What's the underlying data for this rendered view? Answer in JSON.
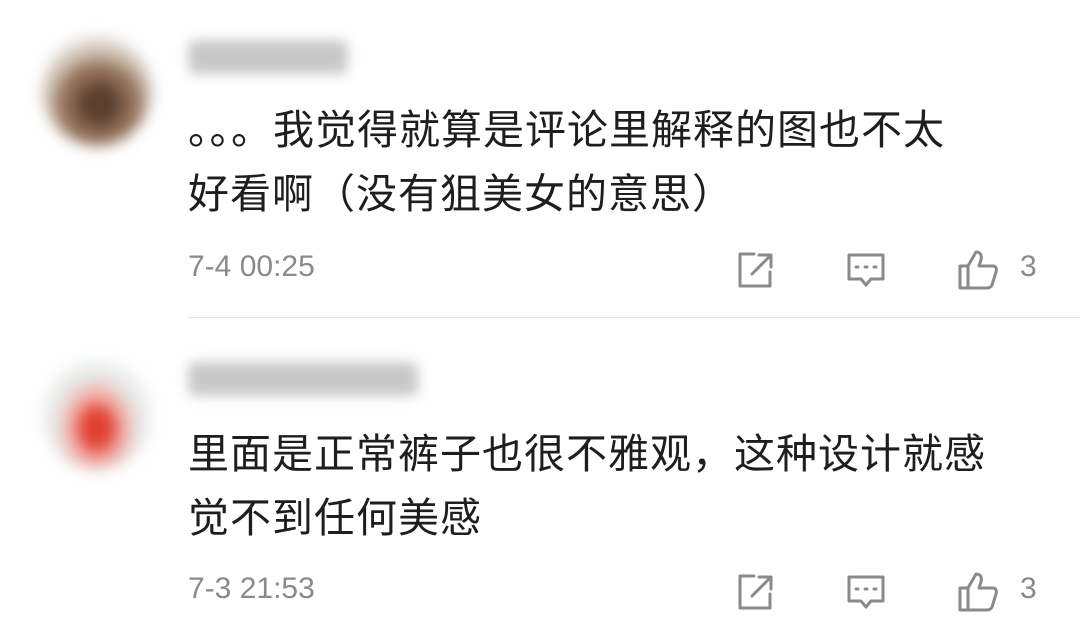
{
  "comments": [
    {
      "username": "",
      "text_line1": "。。。我觉得就算是评论里解释的图也不太",
      "text_line2": "好看啊（没有狙美女的意思）",
      "timestamp": "7-4 00:25",
      "likes": "3"
    },
    {
      "username": "",
      "text_line1": "里面是正常裤子也很不雅观，这种设计就感",
      "text_line2": "觉不到任何美感",
      "timestamp": "7-3 21:53",
      "likes": "3"
    }
  ],
  "icons": {
    "share": "share-icon",
    "reply": "comment-icon",
    "like": "thumbs-up-icon"
  },
  "colors": {
    "text": "#1e1e1e",
    "meta": "#8a8a8a",
    "icon": "#8a8a8a",
    "divider": "#e4e4e4"
  }
}
